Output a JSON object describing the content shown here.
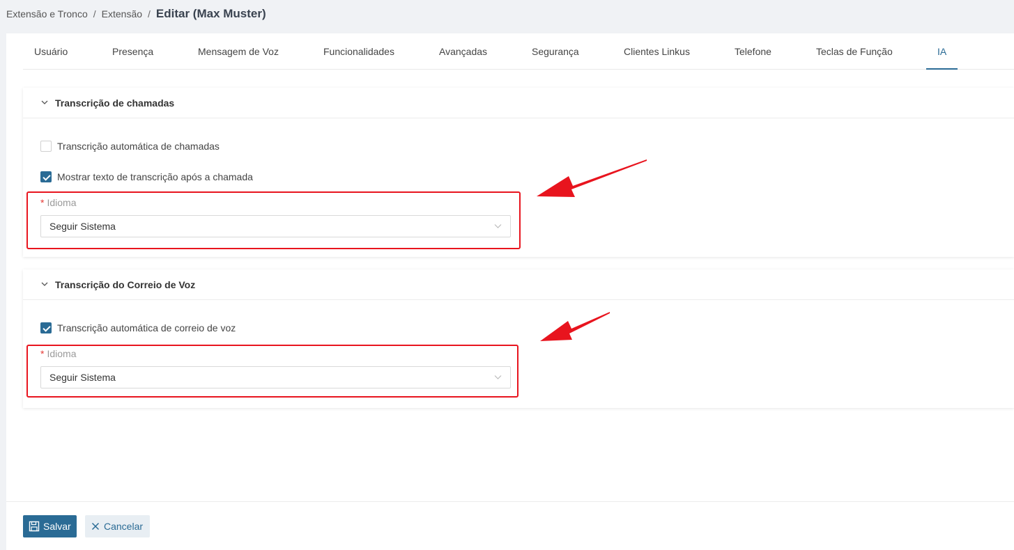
{
  "breadcrumb": {
    "items": [
      "Extensão e Tronco",
      "Extensão"
    ],
    "separator": "/",
    "current": "Editar (Max Muster)"
  },
  "tabs": [
    {
      "label": "Usuário"
    },
    {
      "label": "Presença"
    },
    {
      "label": "Mensagem de Voz"
    },
    {
      "label": "Funcionalidades"
    },
    {
      "label": "Avançadas"
    },
    {
      "label": "Segurança"
    },
    {
      "label": "Clientes Linkus"
    },
    {
      "label": "Telefone"
    },
    {
      "label": "Teclas de Função"
    },
    {
      "label": "IA",
      "active": true
    }
  ],
  "sections": {
    "call_transcription": {
      "title": "Transcrição de chamadas",
      "expanded": true,
      "auto_transcription": {
        "label": "Transcrição automática de chamadas",
        "checked": false
      },
      "show_text": {
        "label": "Mostrar texto de transcrição após a chamada",
        "checked": true
      },
      "language": {
        "required_mark": "*",
        "label": "Idioma",
        "value": "Seguir Sistema"
      }
    },
    "voicemail_transcription": {
      "title": "Transcrição do Correio de Voz",
      "expanded": true,
      "auto_transcription": {
        "label": "Transcrição automática de correio de voz",
        "checked": true
      },
      "language": {
        "required_mark": "*",
        "label": "Idioma",
        "value": "Seguir Sistema"
      }
    }
  },
  "footer": {
    "save_label": "Salvar",
    "cancel_label": "Cancelar"
  },
  "icons": {
    "save": "save-icon",
    "cancel": "close-icon",
    "collapse": "chevron-down-icon",
    "select": "chevron-down-icon",
    "annotation": "red-arrow-icon"
  },
  "colors": {
    "accent": "#2a6b95",
    "annotation": "#e8141e",
    "required": "#e53935"
  }
}
